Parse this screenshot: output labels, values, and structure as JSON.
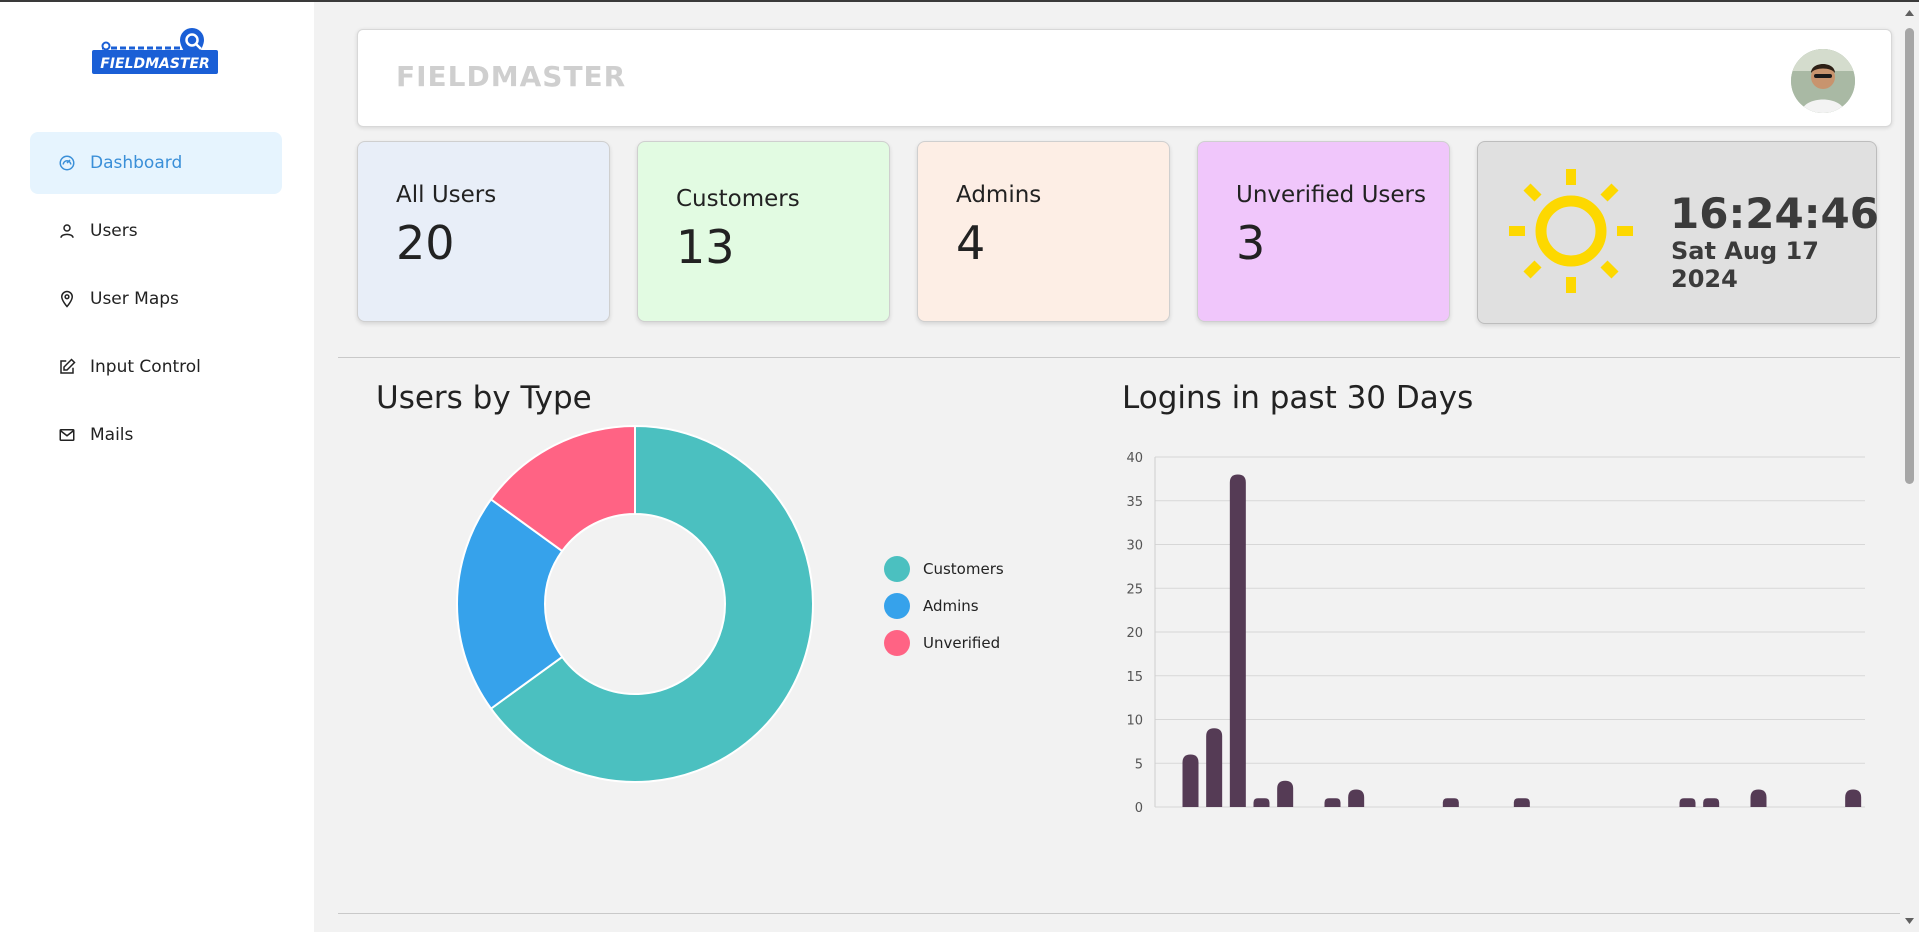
{
  "app": {
    "logo_text": "FIELDMASTER",
    "header_title": "FIELDMASTER"
  },
  "sidebar": {
    "items": [
      {
        "label": "Dashboard",
        "icon": "dashboard-gauge-icon",
        "active": true
      },
      {
        "label": "Users",
        "icon": "user-icon",
        "active": false
      },
      {
        "label": "User Maps",
        "icon": "map-pin-icon",
        "active": false
      },
      {
        "label": "Input Control",
        "icon": "edit-icon",
        "active": false
      },
      {
        "label": "Mails",
        "icon": "mail-icon",
        "active": false
      }
    ]
  },
  "stats": [
    {
      "label": "All Users",
      "value": "20",
      "color": "#e8eef8"
    },
    {
      "label": "Customers",
      "value": "13",
      "color": "#e2fbe2"
    },
    {
      "label": "Admins",
      "value": "4",
      "color": "#fdeee5"
    },
    {
      "label": "Unverified Users",
      "value": "3",
      "color": "#f0c6fb"
    }
  ],
  "clock": {
    "time": "16:24:46",
    "date": "Sat Aug 17 2024",
    "icon": "sun-icon",
    "sun_color": "#fdd800"
  },
  "sections": {
    "users_by_type": "Users by Type",
    "logins": "Logins in past 30 Days"
  },
  "colors": {
    "customers": "#4bc0c0",
    "admins": "#36a2eb",
    "unverified": "#ff6384",
    "bars": "#553b55",
    "active_nav": "#3a8fd8"
  },
  "chart_data": [
    {
      "type": "pie",
      "title": "Users by Type",
      "categories": [
        "Customers",
        "Admins",
        "Unverified"
      ],
      "values": [
        13,
        4,
        3
      ],
      "colors": [
        "#4bc0c0",
        "#36a2eb",
        "#ff6384"
      ],
      "legend": "right"
    },
    {
      "type": "bar",
      "title": "Logins in past 30 Days",
      "values": [
        0,
        6,
        9,
        38,
        1,
        3,
        0,
        1,
        2,
        0,
        0,
        0,
        1,
        0,
        0,
        1,
        0,
        0,
        0,
        0,
        0,
        0,
        1,
        1,
        0,
        2,
        0,
        0,
        0,
        2
      ],
      "yticks": [
        "0",
        "5",
        "10",
        "15",
        "20",
        "25",
        "30",
        "35",
        "40"
      ],
      "ylim": [
        0,
        40
      ],
      "grid": true,
      "color": "#553b55"
    }
  ]
}
